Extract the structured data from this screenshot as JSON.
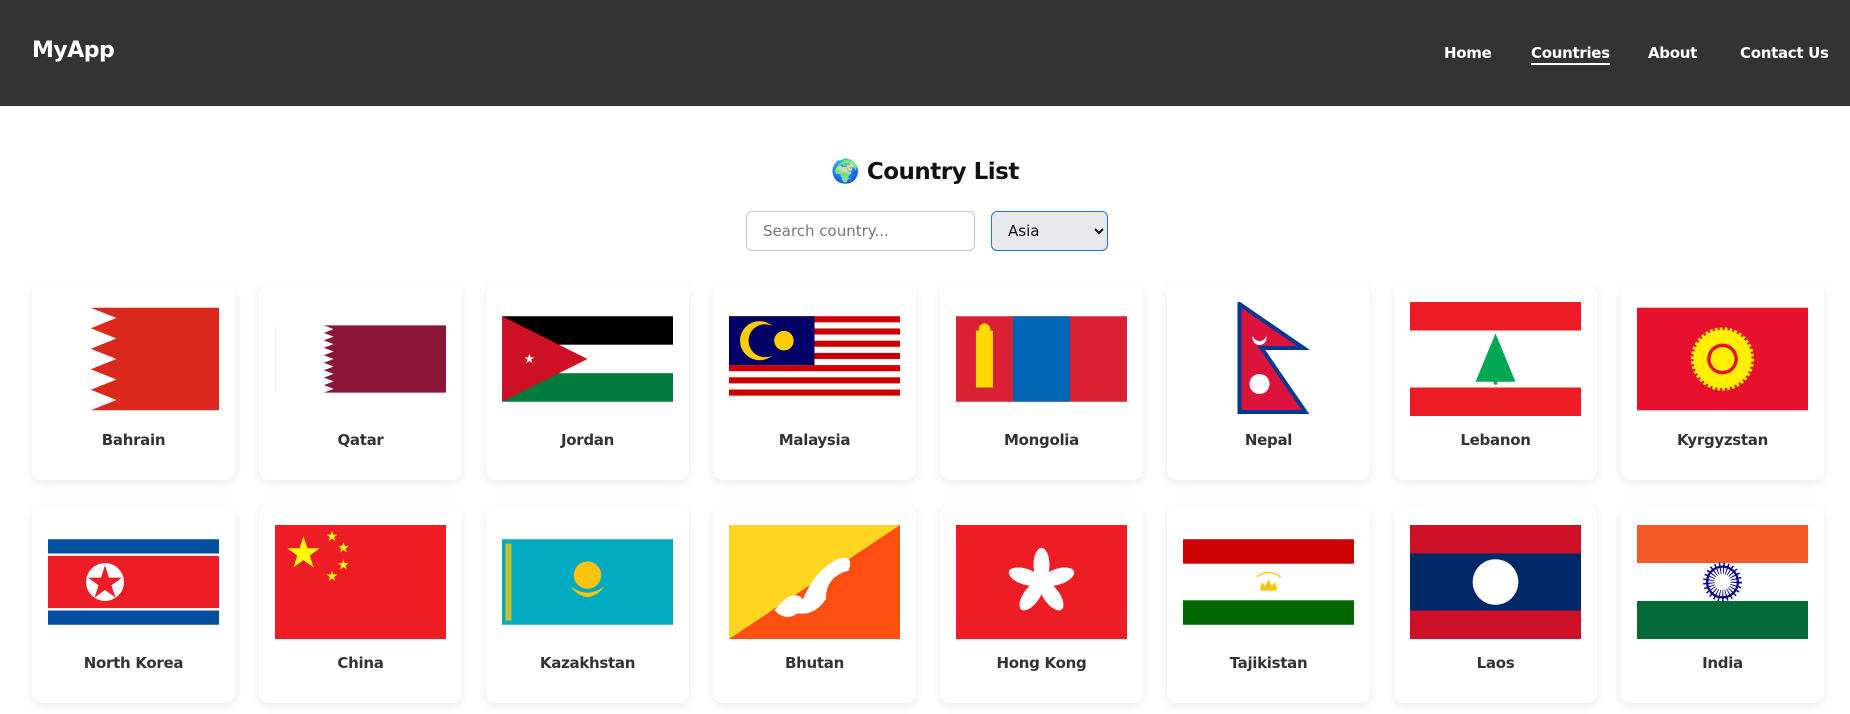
{
  "header": {
    "brand": "MyApp",
    "nav": [
      {
        "label": "Home",
        "active": false
      },
      {
        "label": "Countries",
        "active": true
      },
      {
        "label": "About",
        "active": false
      },
      {
        "label": "Contact Us",
        "active": false
      }
    ]
  },
  "main": {
    "title_icon": "🌍",
    "title": "Country List",
    "search_placeholder": "Search country...",
    "search_value": "",
    "region_selected": "Asia"
  },
  "countries": [
    {
      "name": "Bahrain"
    },
    {
      "name": "Qatar"
    },
    {
      "name": "Jordan"
    },
    {
      "name": "Malaysia"
    },
    {
      "name": "Mongolia"
    },
    {
      "name": "Nepal"
    },
    {
      "name": "Lebanon"
    },
    {
      "name": "Kyrgyzstan"
    },
    {
      "name": "North Korea"
    },
    {
      "name": "China"
    },
    {
      "name": "Kazakhstan"
    },
    {
      "name": "Bhutan"
    },
    {
      "name": "Hong Kong"
    },
    {
      "name": "Tajikistan"
    },
    {
      "name": "Laos"
    },
    {
      "name": "India"
    }
  ],
  "colors": {
    "header_bg": "#333333",
    "accent": "#1a73e8"
  }
}
